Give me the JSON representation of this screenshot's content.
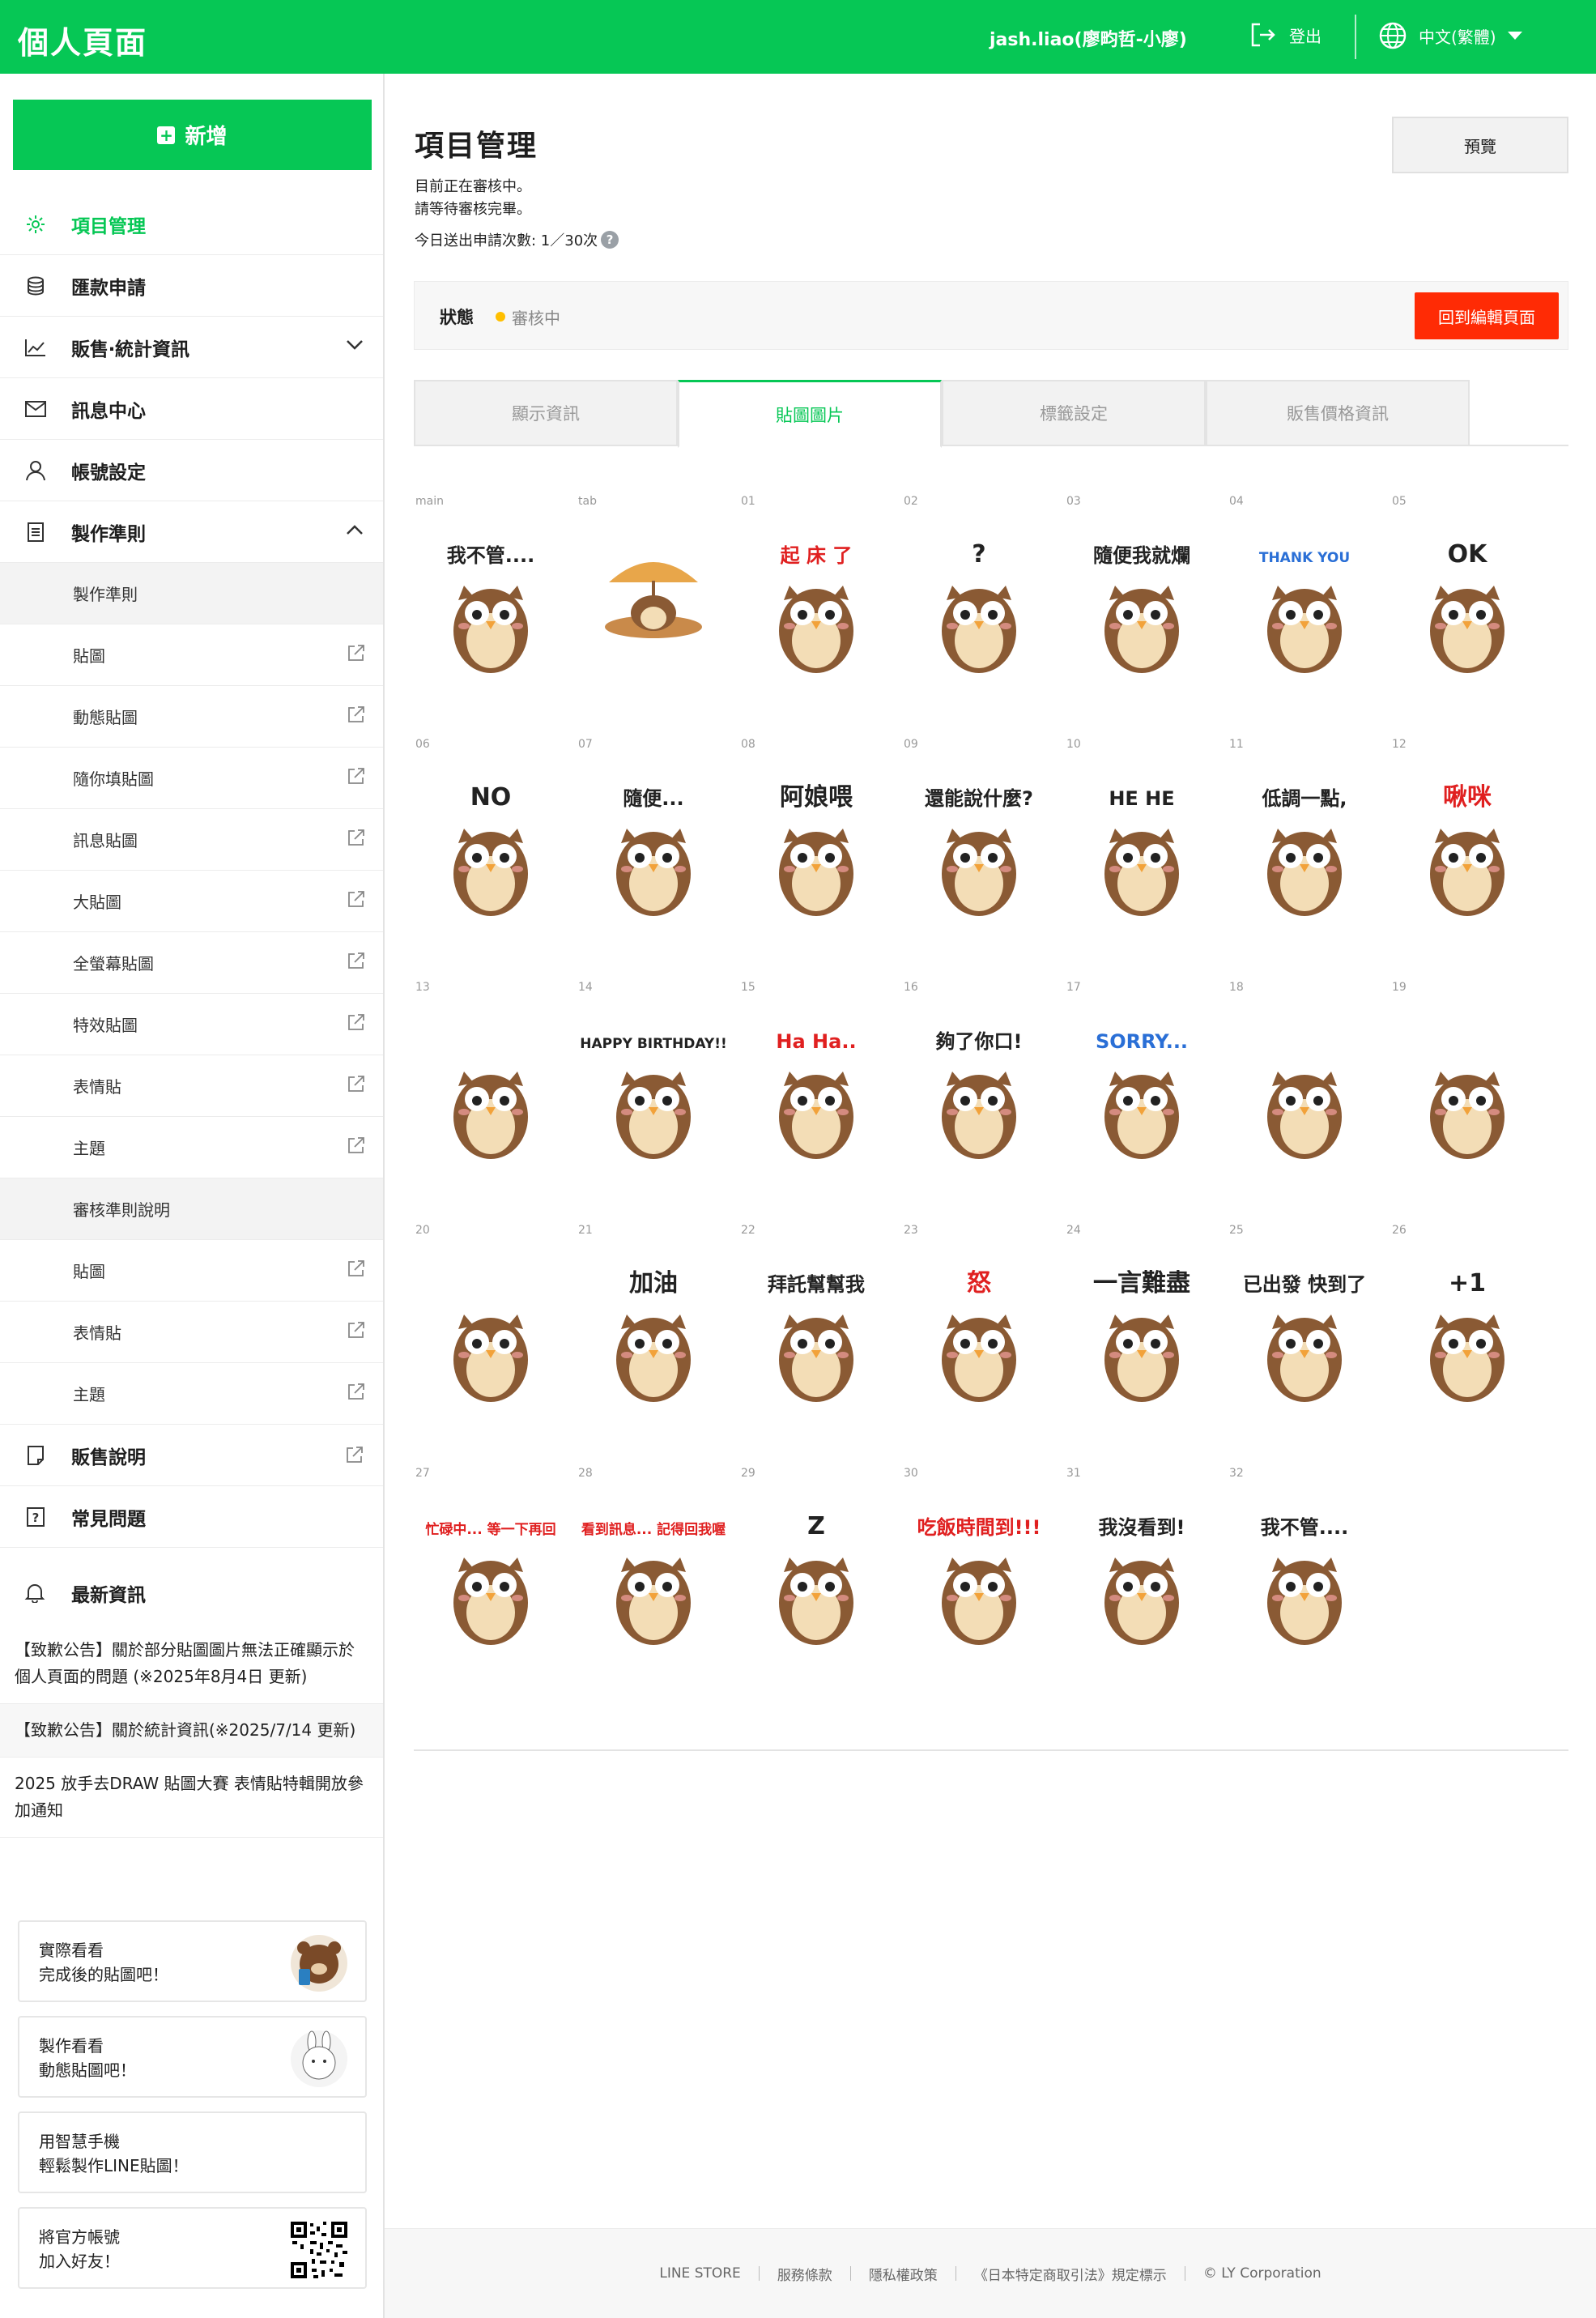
{
  "header": {
    "title": "個人頁面",
    "user": "jash.liao(廖畇哲-小廖)",
    "logout": "登出",
    "language": "中文(繁體)"
  },
  "sidebar": {
    "new_button": "新增",
    "nav": [
      {
        "label": "項目管理",
        "icon": "gear-icon"
      },
      {
        "label": "匯款申請",
        "icon": "coins-icon"
      },
      {
        "label": "販售‧統計資訊",
        "icon": "chart-icon"
      },
      {
        "label": "訊息中心",
        "icon": "mail-icon"
      },
      {
        "label": "帳號設定",
        "icon": "person-icon"
      },
      {
        "label": "製作準則",
        "icon": "document-icon"
      }
    ],
    "guideline_items": [
      "製作準則",
      "貼圖",
      "動態貼圖",
      "隨你填貼圖",
      "訊息貼圖",
      "大貼圖",
      "全螢幕貼圖",
      "特效貼圖",
      "表情貼",
      "主題"
    ],
    "review_header": "審核準則說明",
    "review_items": [
      "貼圖",
      "表情貼",
      "主題"
    ],
    "sales_info": "販售說明",
    "faq": "常見問題",
    "latest_news": "最新資訊",
    "notices": [
      "【致歉公告】關於部分貼圖圖片無法正確顯示於個人頁面的問題 (※2025年8月4日 更新)",
      "【致歉公告】關於統計資訊(※2025/7/14 更新)",
      "2025 放手去DRAW 貼圖大賽 表情貼特輯開放參加通知"
    ],
    "promos": [
      {
        "line1": "實際看看",
        "line2": "完成後的貼圖吧！"
      },
      {
        "line1": "製作看看",
        "line2": "動態貼圖吧！"
      },
      {
        "line1": "用智慧手機",
        "line2": "輕鬆製作LINE貼圖！"
      },
      {
        "line1": "將官方帳號",
        "line2": "加入好友！"
      }
    ]
  },
  "main": {
    "title": "項目管理",
    "message_line1": "目前正在審核中。",
    "message_line2": "請等待審核完畢。",
    "daily_count": "今日送出申請次數: 1／30次",
    "preview_button": "預覽",
    "status_label": "狀態",
    "status_value": "審核中",
    "status_color": "#ffbf00",
    "back_button": "回到編輯頁面",
    "tabs": [
      "顯示資訊",
      "貼圖圖片",
      "標籤設定",
      "販售價格資訊"
    ],
    "active_tab": "貼圖圖片",
    "sticker_ids": [
      "main",
      "tab",
      "01",
      "02",
      "03",
      "04",
      "05",
      "06",
      "07",
      "08",
      "09",
      "10",
      "11",
      "12",
      "13",
      "14",
      "15",
      "16",
      "17",
      "18",
      "19",
      "20",
      "21",
      "22",
      "23",
      "24",
      "25",
      "26",
      "27",
      "28",
      "29",
      "30",
      "31",
      "32"
    ],
    "sticker_captions": {
      "main": "我不管....",
      "01": "起 床 了",
      "02": "?",
      "03": "隨便我就爛",
      "04": "THANK YOU",
      "05": "OK",
      "06": "NO",
      "07": "隨便...",
      "08": "阿娘喂",
      "09": "還能說什麼?",
      "10": "HE HE",
      "11": "低調一點,",
      "12": "啾咪",
      "14": "HAPPY BIRTHDAY!!",
      "15": "Ha Ha..",
      "16": "夠了你口!",
      "17": "SORRY...",
      "21": "加油",
      "22": "拜託幫幫我",
      "23": "怒",
      "24": "一言難盡",
      "25": "已出發 快到了",
      "26": "+1",
      "27": "忙碌中... 等一下再回",
      "28": "看到訊息... 記得回我喔",
      "29": "Z",
      "30": "吃飯時間到!!!",
      "31": "我沒看到!",
      "32": "我不管...."
    }
  },
  "footer": {
    "links": [
      "LINE STORE",
      "服務條款",
      "隱私權政策",
      "《日本特定商取引法》規定標示",
      "© LY Corporation"
    ]
  },
  "colors": {
    "brand": "#06c755",
    "danger": "#ff2b05",
    "owl_body": "#8a5a34",
    "owl_belly": "#f3ddb6"
  }
}
